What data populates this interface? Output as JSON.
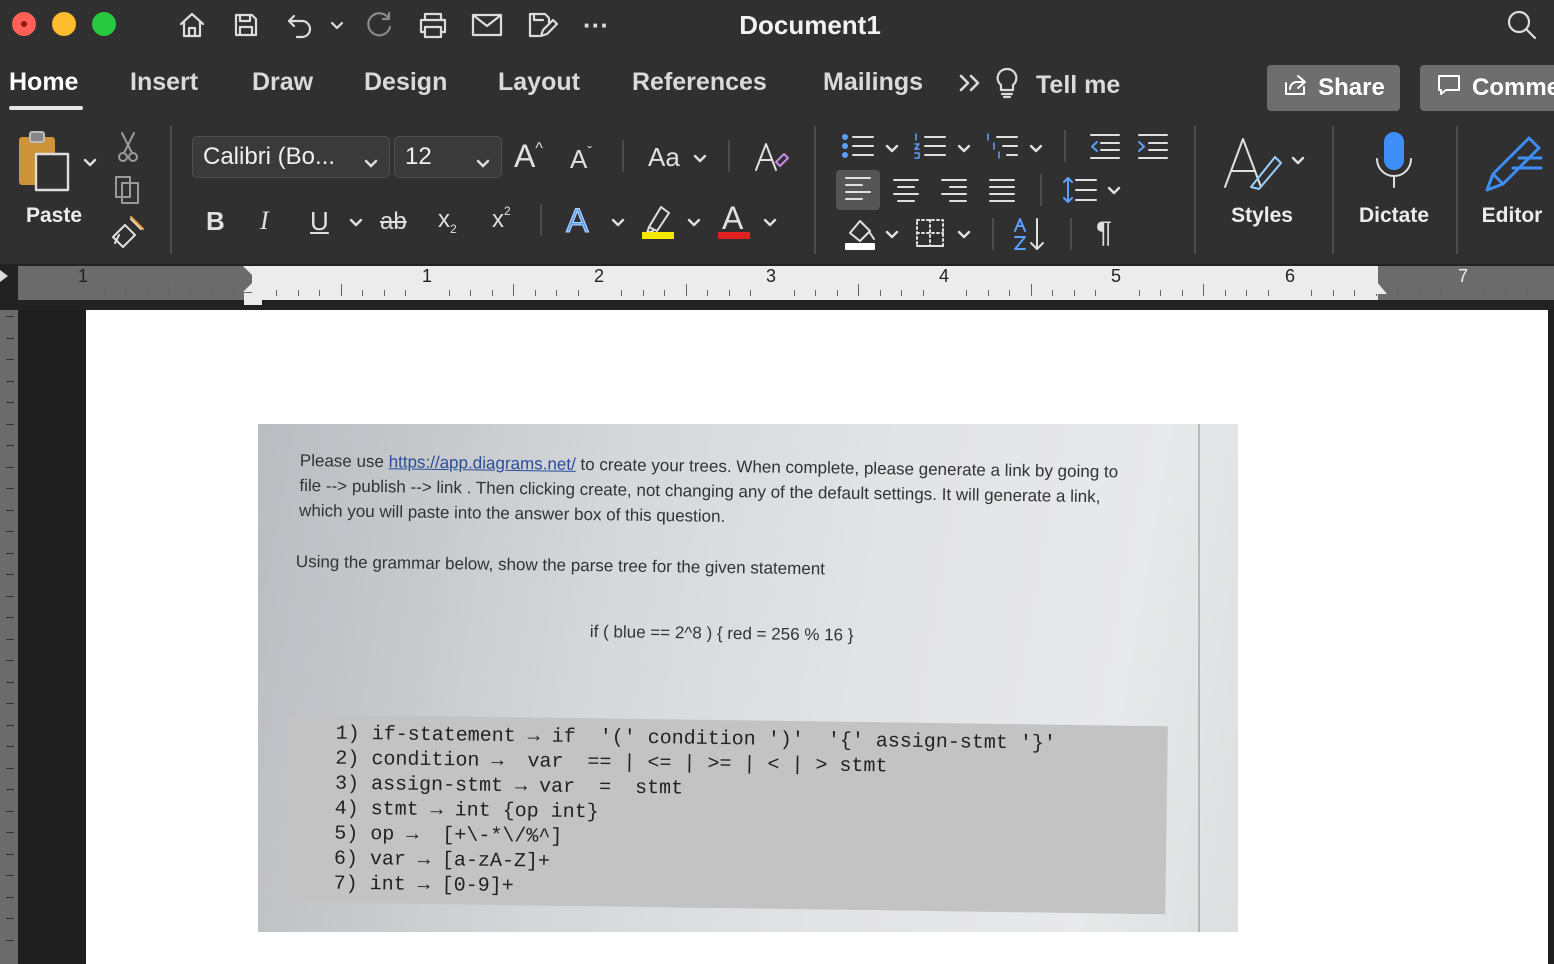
{
  "window": {
    "title": "Document1"
  },
  "tabs": [
    "Home",
    "Insert",
    "Draw",
    "Design",
    "Layout",
    "References",
    "Mailings"
  ],
  "tell_me": "Tell me",
  "share_label": "Share",
  "comments_label": "Comme",
  "ribbon": {
    "paste_label": "Paste",
    "font_name": "Calibri (Bo...",
    "font_size": "12",
    "change_case": "Aa",
    "styles_label": "Styles",
    "dictate_label": "Dictate",
    "editor_label": "Editor",
    "bold": "B",
    "italic": "I",
    "underline": "U",
    "strike": "ab",
    "subscript": "x",
    "subscript_mark": "2",
    "superscript": "x",
    "superscript_mark": "2",
    "grow": "A",
    "shrink": "A",
    "text_effect": "A",
    "font_color": "A",
    "highlight_color": "#f5e900",
    "font_color_hex": "#e02020",
    "pilcrow": "¶"
  },
  "ruler": {
    "numbers": [
      "1",
      "1",
      "2",
      "3",
      "4",
      "5",
      "6",
      "7"
    ]
  },
  "document": {
    "intro_pre": "Please use ",
    "intro_link": "https://app.diagrams.net/",
    "intro_line1": " to create your trees. When complete, please generate a link by going to",
    "intro_line2": "file --> publish --> link . Then clicking create, not changing any of the default settings. It will generate a link,",
    "intro_line3": "which you will paste into the answer box of this question.",
    "instruction": "Using the grammar below, show the parse tree for the given statement",
    "statement": "if ( blue == 2^8 ) { red = 256 % 16 }",
    "grammar": [
      "1) if-statement → if  '(' condition ')'  '{' assign-stmt '}'",
      "2) condition →  var  == | <= | >= | < | > stmt",
      "3) assign-stmt → var  =  stmt",
      "4) stmt → int {op int}",
      "5) op →  [+\\-*\\/%^]",
      "6) var → [a-zA-Z]+",
      "7) int → [0-9]+"
    ]
  }
}
